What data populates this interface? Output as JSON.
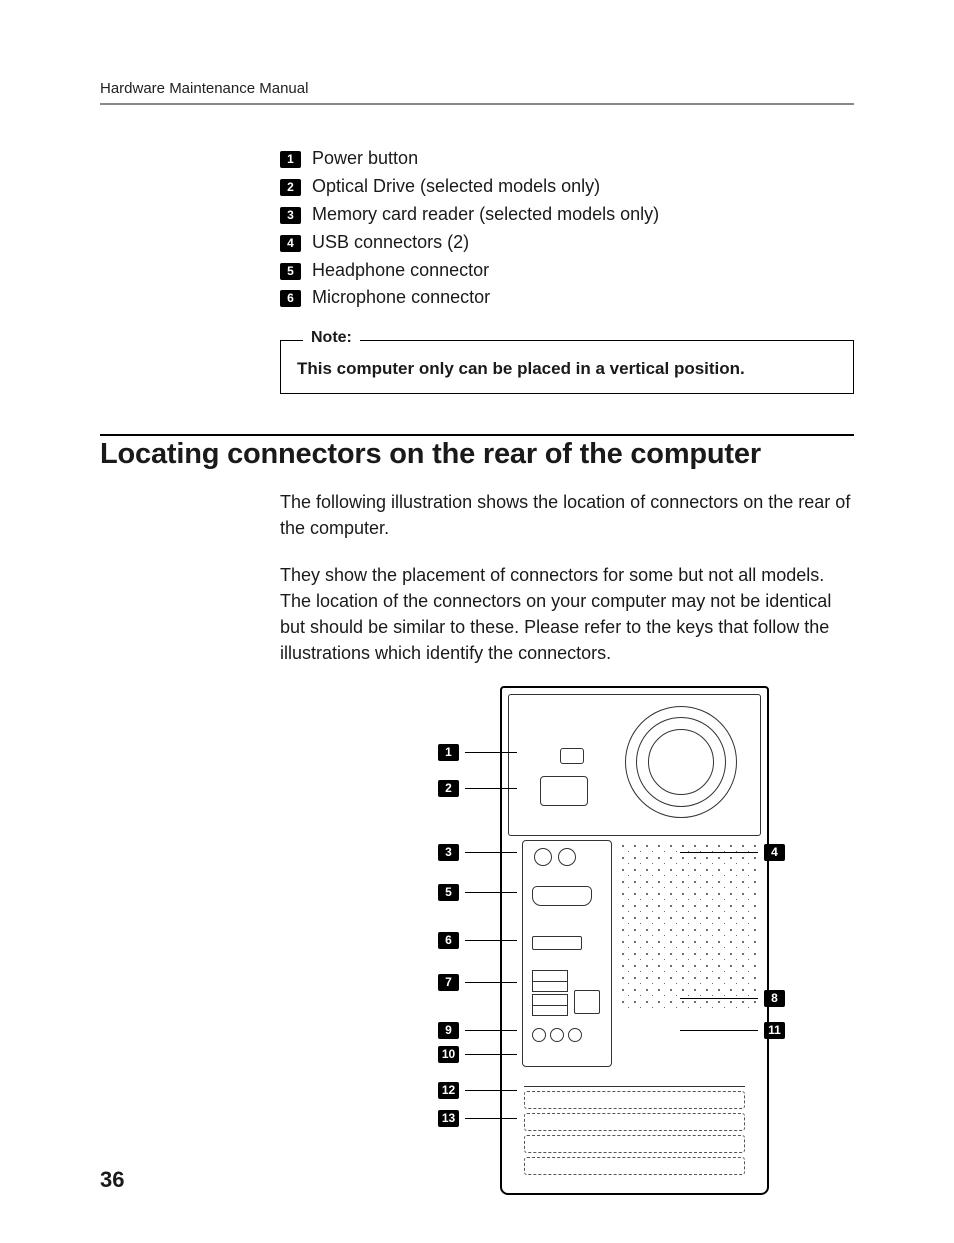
{
  "header": {
    "running_head": "Hardware Maintenance Manual"
  },
  "front_list": {
    "items": [
      {
        "n": "1",
        "label": "Power button"
      },
      {
        "n": "2",
        "label": "Optical Drive (selected models only)"
      },
      {
        "n": "3",
        "label": "Memory card reader (selected models only)"
      },
      {
        "n": "4",
        "label": "USB connectors (2)"
      },
      {
        "n": "5",
        "label": "Headphone connector"
      },
      {
        "n": "6",
        "label": "Microphone connector"
      }
    ]
  },
  "note": {
    "label": "Note:",
    "text": "This computer only can be placed in a vertical position."
  },
  "section": {
    "title": "Locating connectors on the rear of the computer",
    "para1": "The following illustration shows the location of connectors on the rear of the computer.",
    "para2": "They show the placement of connectors for some but not all models. The location of the connectors on your computer may not be identical but should be similar to these. Please refer to the keys that follow the illustrations which identify the connectors."
  },
  "rear_callouts": {
    "left": [
      "1",
      "2",
      "3",
      "5",
      "6",
      "7",
      "9",
      "10",
      "12",
      "13"
    ],
    "right": [
      "4",
      "8",
      "11"
    ]
  },
  "page_number": "36"
}
